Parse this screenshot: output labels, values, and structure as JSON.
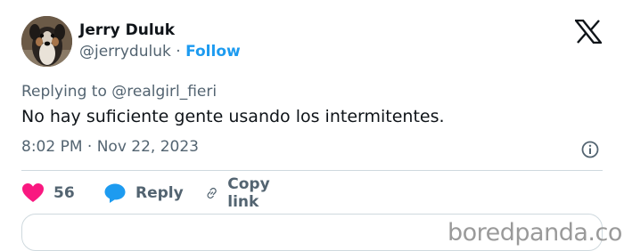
{
  "author": {
    "name": "Jerry Duluk",
    "handle": "@jerryduluk",
    "separator": "·",
    "follow_label": "Follow"
  },
  "platform_icon": "x-logo-icon",
  "reply_context": {
    "prefix": "Replying to ",
    "target": "@realgirl_fieri"
  },
  "tweet": {
    "text": "No hay suficiente gente usando los intermitentes.",
    "timestamp": "8:02 PM · Nov 22, 2023"
  },
  "actions": {
    "likes_count": "56",
    "reply_label": "Reply",
    "copy_link_label": "Copy link"
  },
  "watermark": "boredpanda.com",
  "colors": {
    "accent": "#1d9bf0",
    "heart": "#f91880",
    "text_secondary": "#536471"
  }
}
